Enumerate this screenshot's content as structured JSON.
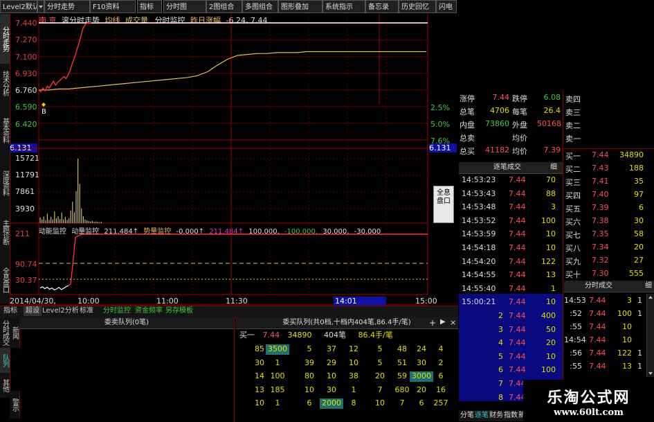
{
  "toolbar": [
    "Level2默认",
    "分时走势",
    "F10资料",
    "指标",
    "分时图",
    "2图组合",
    "多图组合",
    "图形叠加",
    "系统指示",
    "备忘录",
    "历史回忆",
    "闪电"
  ],
  "side_tabs": [
    "分时走势",
    "技术分析",
    "基本资料",
    "深度资料",
    "主题诊断",
    "全息盘口"
  ],
  "side_tabs_lower": [
    "分时成交",
    "队列",
    "其他"
  ],
  "lower_side_small": [
    "新闻",
    "警示"
  ],
  "chart_header": {
    "name": "南 京",
    "title": "滚分时走势",
    "avg": "均线",
    "vol": "成交量",
    "monitor": "分时监控",
    "prev": "昨日涨幅",
    "prev_val": "-6.24, 7.44"
  },
  "price_axis": [
    "7.440",
    "7.270",
    "7.100",
    "6.930",
    "6.760",
    "6.590",
    "6.420",
    "6.131"
  ],
  "pct_axis": [
    "2.5%",
    "5.0%",
    "7.6%",
    "6.131"
  ],
  "vol_axis": [
    "15721",
    "11791",
    "7861",
    "3930"
  ],
  "indicator_header": {
    "l1": "动能监控",
    "l2": "动量监控",
    "v1": "211.484↑",
    "l3": "势量监控",
    "v2": "-0.000↑",
    "v3": "211.484↑",
    "v4": "100.000,",
    "v5": "-100.000,",
    "v6": "30.000,",
    "v7": "-30.000"
  },
  "indicator_axis": [
    "211",
    "90.74",
    "30.37"
  ],
  "b_marker": "B",
  "time_axis": [
    "2014/04/30, 09:30",
    "10:00",
    "11:00",
    "11:30",
    "14:01",
    "15:00"
  ],
  "bottom_tabs": [
    "指标",
    "超设",
    "Level2分析",
    "标准",
    "分时监控",
    "资金频率",
    "另存模板"
  ],
  "float_button": "全息盘口",
  "quote": {
    "rows": [
      {
        "l": "涨停",
        "v": "7.44",
        "l2": "跌停",
        "v2": "6.08"
      },
      {
        "l": "总笔",
        "v": "4706",
        "l2": "每笔",
        "v2": "26.4"
      },
      {
        "l": "内盘",
        "v": "73860",
        "l2": "外盘",
        "v2": "50168"
      },
      {
        "l": "总卖",
        "v": "",
        "l2": "均价",
        "v2": ""
      },
      {
        "l": "总买",
        "v": "41182",
        "l2": "均价",
        "v2": "7.39"
      }
    ]
  },
  "sell_levels": [
    "卖四",
    "卖三",
    "卖二",
    "卖一"
  ],
  "buy_levels": [
    {
      "l": "买一",
      "p": "7.44",
      "v": "34890"
    },
    {
      "l": "买二",
      "p": "7.43",
      "v": "188"
    },
    {
      "l": "买三",
      "p": "7.41",
      "v": "35"
    },
    {
      "l": "买四",
      "p": "7.40",
      "v": "97"
    },
    {
      "l": "买五",
      "p": "7.39",
      "v": "6"
    },
    {
      "l": "买六",
      "p": "7.38",
      "v": "30"
    },
    {
      "l": "买七",
      "p": "7.35",
      "v": "58"
    },
    {
      "l": "买八",
      "p": "7.34",
      "v": "20"
    },
    {
      "l": "买九",
      "p": "7.32",
      "v": "27"
    },
    {
      "l": "买十",
      "p": "7.30",
      "v": "555"
    }
  ],
  "ticks_title": "逐笔成交",
  "ticks_btn": "细",
  "ticks": [
    {
      "t": "14:53:23",
      "p": "7.44",
      "v": "70"
    },
    {
      "t": "14:53:43",
      "p": "7.44",
      "v": "88"
    },
    {
      "t": "14:53:48",
      "p": "7.44",
      "v": "3"
    },
    {
      "t": "14:53:52",
      "p": "7.44",
      "v": "100"
    },
    {
      "t": "14:53:59",
      "p": "7.44",
      "v": "10"
    },
    {
      "t": "14:54:18",
      "p": "7.44",
      "v": "10"
    },
    {
      "t": "14:54:20",
      "p": "7.44",
      "v": "122"
    },
    {
      "t": "14:54:55",
      "p": "7.44",
      "v": "13"
    },
    {
      "t": "14:55:40",
      "p": "7.44",
      "v": "1"
    },
    {
      "t": "15:00:21",
      "p": "7.44",
      "v": "10"
    },
    {
      "t": "2",
      "p": "7.44",
      "v": "400"
    },
    {
      "t": "3",
      "p": "7.44",
      "v": "50"
    },
    {
      "t": "4",
      "p": "7.44",
      "v": "20"
    },
    {
      "t": "5",
      "p": "7.44",
      "v": "10"
    },
    {
      "t": "6",
      "p": "7.44",
      "v": "100"
    },
    {
      "t": "7",
      "p": "7.44",
      "v": "10"
    },
    {
      "t": "8",
      "p": "7.44",
      "v": "10"
    }
  ],
  "min_title": "分时成交",
  "min_btn": "细",
  "min_ticks": [
    {
      "t": "14:53",
      "p": "7.44",
      "v": "3",
      "n": "1"
    },
    {
      "t": ":52",
      "p": "7.44",
      "v": "100",
      "n": "1"
    },
    {
      "t": ":55",
      "p": "7.44",
      "v": "10",
      "n": ""
    },
    {
      "t": "14:54",
      "p": "7.44",
      "v": "10",
      "n": ""
    },
    {
      "t": ":56",
      "p": "7.44",
      "v": "122",
      "n": "1"
    },
    {
      "t": ":55",
      "p": "7.44",
      "v": "13",
      "n": "1"
    }
  ],
  "sell_queue_title": "委卖队列(0笔)",
  "buy_queue_title": "委买队列(共0档,十档内404笔,86.4手/笔)",
  "buy_queue_summary": {
    "l": "买一",
    "p": "7.44",
    "v": "34890",
    "n": "404笔",
    "avg": "86.4手/笔"
  },
  "queue_rows": [
    [
      "85",
      "3500",
      "5",
      "37",
      "12",
      "5",
      "48",
      "24",
      "4"
    ],
    [
      "30",
      "1",
      "39",
      "29",
      "10",
      "5",
      "51",
      "30",
      "2"
    ],
    [
      "14",
      "100",
      "80",
      "10",
      "38",
      "20",
      "59",
      "3000",
      "6"
    ],
    [
      "13",
      "185",
      "10",
      "30",
      "1",
      "7",
      "680",
      "20",
      "16"
    ],
    [
      "10",
      "1",
      "6",
      "2000",
      "8",
      "10",
      "7",
      "6",
      "257"
    ]
  ],
  "queue_highlight": [
    [
      0,
      1
    ],
    [
      2,
      7
    ],
    [
      4,
      3
    ]
  ],
  "bottom_right_tabs": [
    "分笔",
    "逐笔",
    "财务",
    "指数",
    "新闻"
  ],
  "watermark": {
    "cn": "乐淘公式网",
    "url": "www.60lt.com"
  },
  "colors": {
    "up": "#e84040",
    "down": "#3ec83e",
    "grid": "#8a0000",
    "price": "#ff3030",
    "avg": "#e0c060",
    "vol": "#c8b878",
    "blue": "#1010a0"
  },
  "chart_data": [
    {
      "type": "line",
      "series": [
        {
          "values": [
            6.74,
            6.72,
            6.76,
            6.73,
            6.78,
            6.76,
            6.8,
            6.83,
            6.79,
            6.82,
            6.84,
            6.86,
            6.88,
            6.86,
            6.9,
            6.95,
            7.02,
            7.08,
            7.15,
            7.22,
            7.3,
            7.38,
            7.42,
            7.44,
            7.44,
            7.44
          ]
        },
        {
          "values": [
            6.74,
            6.74,
            6.75,
            6.75,
            6.76,
            6.77,
            6.78,
            6.79,
            6.8,
            6.81,
            6.82,
            6.83,
            6.84,
            6.85,
            6.86,
            6.87,
            6.89,
            6.93,
            7.0,
            7.06,
            7.1,
            7.11,
            7.12,
            7.12,
            7.13,
            7.13,
            7.13,
            7.14,
            7.14,
            7.14,
            7.14,
            7.14,
            7.14,
            7.14,
            7.14,
            7.14,
            7.14,
            7.14,
            7.14,
            7.14
          ]
        }
      ],
      "ylim": [
        6.131,
        7.44
      ]
    },
    {
      "type": "bar",
      "values": [
        1400,
        900,
        1600,
        700,
        2300,
        800,
        1500,
        900,
        2800,
        1200,
        1700,
        1000,
        2600,
        900,
        1500,
        800,
        1200,
        3100,
        5200,
        2600,
        7800,
        15721,
        9600,
        3600,
        1700,
        900,
        700,
        500,
        400,
        600,
        300,
        400,
        300,
        200,
        300
      ],
      "ylim": [
        0,
        15721
      ]
    },
    {
      "type": "line",
      "values": [
        30,
        34,
        28,
        33,
        26,
        30,
        24,
        27,
        32,
        25,
        29,
        35,
        38,
        45,
        120,
        200,
        205,
        208,
        211,
        211,
        211,
        211,
        211,
        211,
        211,
        211,
        211,
        211,
        211,
        211,
        211,
        211,
        211,
        211,
        211,
        211,
        211,
        211,
        211,
        211
      ],
      "ylim": [
        20,
        211
      ]
    }
  ]
}
